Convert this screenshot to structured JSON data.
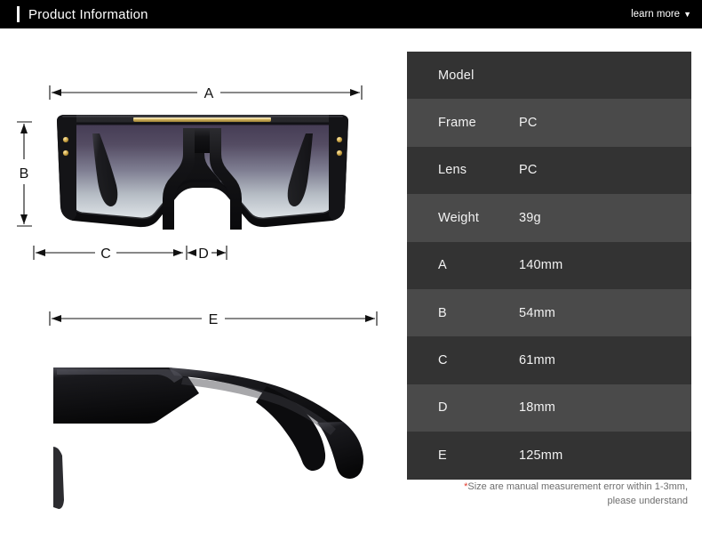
{
  "header": {
    "title": "Product Information",
    "learn_more_label": "learn more",
    "caret_icon": "chevron-down-icon",
    "background_color": "#000000",
    "text_color": "#ffffff"
  },
  "diagram": {
    "front_view": {
      "name": "sunglasses-front-view",
      "description": "black shield sunglasses front view with gradient lens and gold brow bar",
      "frame_color": "#111111",
      "brow_bar_color": "#c9a84c",
      "rivet_color": "#c9a84c",
      "lens_gradient_top": "#4a4158",
      "lens_gradient_bottom": "#d8dde2"
    },
    "side_view": {
      "name": "sunglasses-side-view",
      "description": "black sunglasses folded side view showing temple arms",
      "frame_color": "#111111"
    },
    "measurements": [
      {
        "id": "A",
        "label": "A",
        "orientation": "horizontal",
        "position": "top-front"
      },
      {
        "id": "B",
        "label": "B",
        "orientation": "vertical",
        "position": "left-front"
      },
      {
        "id": "C",
        "label": "C",
        "orientation": "horizontal",
        "position": "bottom-front-left"
      },
      {
        "id": "D",
        "label": "D",
        "orientation": "horizontal",
        "position": "bottom-front-right"
      },
      {
        "id": "E",
        "label": "E",
        "orientation": "horizontal",
        "position": "top-side"
      }
    ]
  },
  "spec_table": {
    "row_color_dark": "#333333",
    "row_color_light": "#4a4a4a",
    "rows": [
      {
        "label": "Model",
        "value": ""
      },
      {
        "label": "Frame",
        "value": "PC"
      },
      {
        "label": "Lens",
        "value": "PC"
      },
      {
        "label": "Weight",
        "value": "39g"
      },
      {
        "label": "A",
        "value": "140mm"
      },
      {
        "label": "B",
        "value": "54mm"
      },
      {
        "label": "C",
        "value": "61mm"
      },
      {
        "label": "D",
        "value": "18mm"
      },
      {
        "label": "E",
        "value": "125mm"
      }
    ],
    "note_asterisk": "*",
    "note_line1": "Size are manual measurement error within 1-3mm,",
    "note_line2": "please understand",
    "note_color": "#6e6e6e",
    "asterisk_color": "#e23b2e"
  }
}
